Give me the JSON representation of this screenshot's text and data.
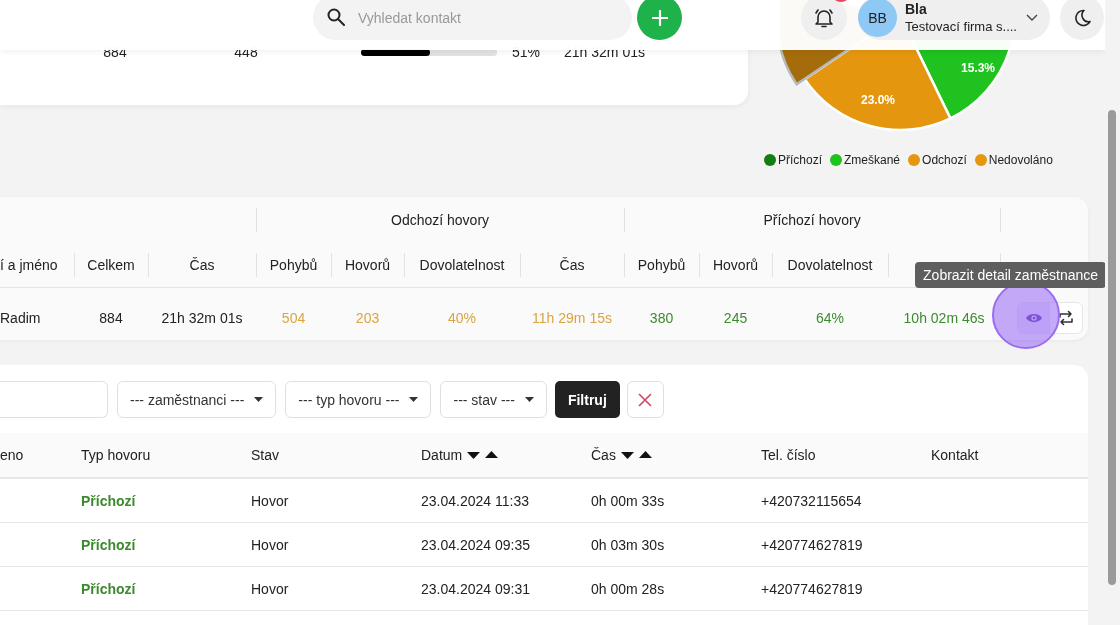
{
  "header": {
    "search": {
      "placeholder": "Vyhledat kontakt"
    },
    "notification_badge": true,
    "user": {
      "initials": "BB",
      "name": "Bla",
      "company": "Testovací firma s...."
    }
  },
  "summary": {
    "total": "884",
    "count": "448",
    "level": 0.51,
    "percent": "51%",
    "time": "21h 32m 01s"
  },
  "pie": {
    "data_labels": [
      "23.0%",
      "15.3%"
    ],
    "legend": [
      {
        "label": "Příchozí",
        "color": "#137d13"
      },
      {
        "label": "Zmeškané",
        "color": "#1fc21f"
      },
      {
        "label": "Odchozí",
        "color": "#e5960f"
      },
      {
        "label": "Nedovoláno",
        "color": "#e5960f"
      }
    ]
  },
  "employees": {
    "groups": [
      "Odchozí hovory",
      "Příchozí hovory"
    ],
    "columns": [
      "í a jméno",
      "Celkem",
      "Čas",
      "Pohybů",
      "Hovorů",
      "Dovolatelnost",
      "Čas",
      "Pohybů",
      "Hovorů",
      "Dovolatelnost"
    ],
    "rows": [
      {
        "cells": [
          {
            "text": "Radim",
            "kind": "name"
          },
          {
            "text": "884",
            "kind": "plain"
          },
          {
            "text": "21h 32m 01s",
            "kind": "plain"
          },
          {
            "text": "504",
            "kind": "out"
          },
          {
            "text": "203",
            "kind": "out"
          },
          {
            "text": "40%",
            "kind": "out"
          },
          {
            "text": "11h 29m 15s",
            "kind": "out"
          },
          {
            "text": "380",
            "kind": "in"
          },
          {
            "text": "245",
            "kind": "in"
          },
          {
            "text": "64%",
            "kind": "in"
          },
          {
            "text": "10h 02m 46s",
            "kind": "in"
          }
        ]
      }
    ],
    "tooltip": "Zobrazit detail zaměstnance"
  },
  "calls": {
    "filters": [
      "--- zaměstnanci ---",
      "--- typ hovoru ---",
      "--- stav ---"
    ],
    "filter_button": "Filtruj",
    "columns": [
      {
        "label": "eno",
        "sortable": false
      },
      {
        "label": "Typ hovoru",
        "sortable": false
      },
      {
        "label": "Stav",
        "sortable": false
      },
      {
        "label": "Datum",
        "sortable": true
      },
      {
        "label": "Čas",
        "sortable": true
      },
      {
        "label": "Tel. číslo",
        "sortable": false
      },
      {
        "label": "Kontakt",
        "sortable": false
      }
    ],
    "rows": [
      {
        "type": "Příchozí",
        "kind": "incoming",
        "status": "Hovor",
        "date": "23.04.2024 11:33",
        "duration": "0h 00m 33s",
        "phone": "+420732115654"
      },
      {
        "type": "Příchozí",
        "kind": "incoming",
        "status": "Hovor",
        "date": "23.04.2024 09:35",
        "duration": "0h 03m 30s",
        "phone": "+420774627819"
      },
      {
        "type": "Příchozí",
        "kind": "incoming",
        "status": "Hovor",
        "date": "23.04.2024 09:31",
        "duration": "0h 00m 28s",
        "phone": "+420774627819"
      }
    ]
  }
}
